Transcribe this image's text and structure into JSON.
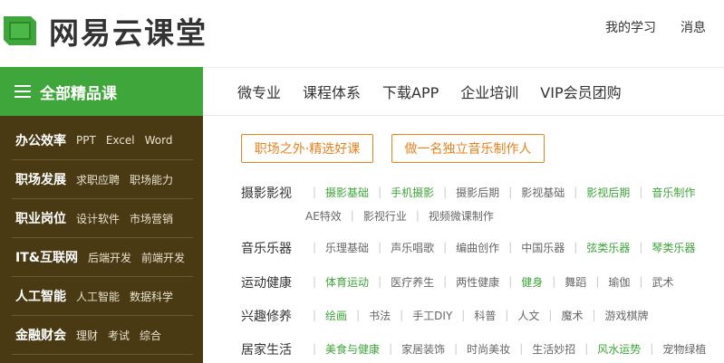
{
  "brand": {
    "name": "网易云课堂",
    "color": "#3ea63a"
  },
  "top_links": [
    "我的学习",
    "消息"
  ],
  "category_button": {
    "label": "全部精品课",
    "icon": "menu-icon"
  },
  "main_nav": [
    "微专业",
    "课程体系",
    "下载APP",
    "企业培训",
    "VIP会员团购"
  ],
  "sidebar": [
    {
      "label": "办公效率",
      "subs": [
        "PPT",
        "Excel",
        "Word"
      ]
    },
    {
      "label": "职场发展",
      "subs": [
        "求职应聘",
        "职场能力"
      ]
    },
    {
      "label": "职业岗位",
      "subs": [
        "设计软件",
        "市场营销"
      ]
    },
    {
      "label": "IT&互联网",
      "subs": [
        "后端开发",
        "前端开发"
      ]
    },
    {
      "label": "人工智能",
      "subs": [
        "人工智能",
        "数据科学"
      ]
    },
    {
      "label": "金融财会",
      "subs": [
        "理财",
        "考试",
        "综合"
      ]
    }
  ],
  "promo_tags": [
    "职场之外·精选好课",
    "做一名独立音乐制作人"
  ],
  "content_rows": [
    {
      "label": "摄影影视",
      "items": [
        {
          "text": "摄影基础",
          "hot": true
        },
        {
          "text": "手机摄影",
          "hot": true
        },
        {
          "text": "摄影后期",
          "hot": false
        },
        {
          "text": "影视基础",
          "hot": false
        },
        {
          "text": "影视后期",
          "hot": true
        },
        {
          "text": "音乐制作",
          "hot": true
        }
      ],
      "items2": [
        {
          "text": "AE特效",
          "hot": false
        },
        {
          "text": "影视行业",
          "hot": false
        },
        {
          "text": "视频微课制作",
          "hot": false
        }
      ]
    },
    {
      "label": "音乐乐器",
      "items": [
        {
          "text": "乐理基础",
          "hot": false
        },
        {
          "text": "声乐唱歌",
          "hot": false
        },
        {
          "text": "编曲创作",
          "hot": false
        },
        {
          "text": "中国乐器",
          "hot": false
        },
        {
          "text": "弦类乐器",
          "hot": true
        },
        {
          "text": "琴类乐器",
          "hot": true
        }
      ]
    },
    {
      "label": "运动健康",
      "items": [
        {
          "text": "体育运动",
          "hot": true
        },
        {
          "text": "医疗养生",
          "hot": false
        },
        {
          "text": "两性健康",
          "hot": false
        },
        {
          "text": "健身",
          "hot": true
        },
        {
          "text": "舞蹈",
          "hot": false
        },
        {
          "text": "瑜伽",
          "hot": false
        },
        {
          "text": "武术",
          "hot": false
        }
      ]
    },
    {
      "label": "兴趣修养",
      "items": [
        {
          "text": "绘画",
          "hot": true
        },
        {
          "text": "书法",
          "hot": false
        },
        {
          "text": "手工DIY",
          "hot": false
        },
        {
          "text": "科普",
          "hot": false
        },
        {
          "text": "人文",
          "hot": false
        },
        {
          "text": "魔术",
          "hot": false
        },
        {
          "text": "游戏棋牌",
          "hot": false
        }
      ]
    },
    {
      "label": "居家生活",
      "items": [
        {
          "text": "美食与健康",
          "hot": true
        },
        {
          "text": "家居装饰",
          "hot": false
        },
        {
          "text": "时尚美妆",
          "hot": false
        },
        {
          "text": "生活妙招",
          "hot": false
        },
        {
          "text": "风水运势",
          "hot": true
        },
        {
          "text": "宠物绿植",
          "hot": false
        }
      ]
    }
  ],
  "colors": {
    "accent": "#3ea63a",
    "sidebar_bg": "#4a3a14",
    "promo": "#e8821c"
  }
}
